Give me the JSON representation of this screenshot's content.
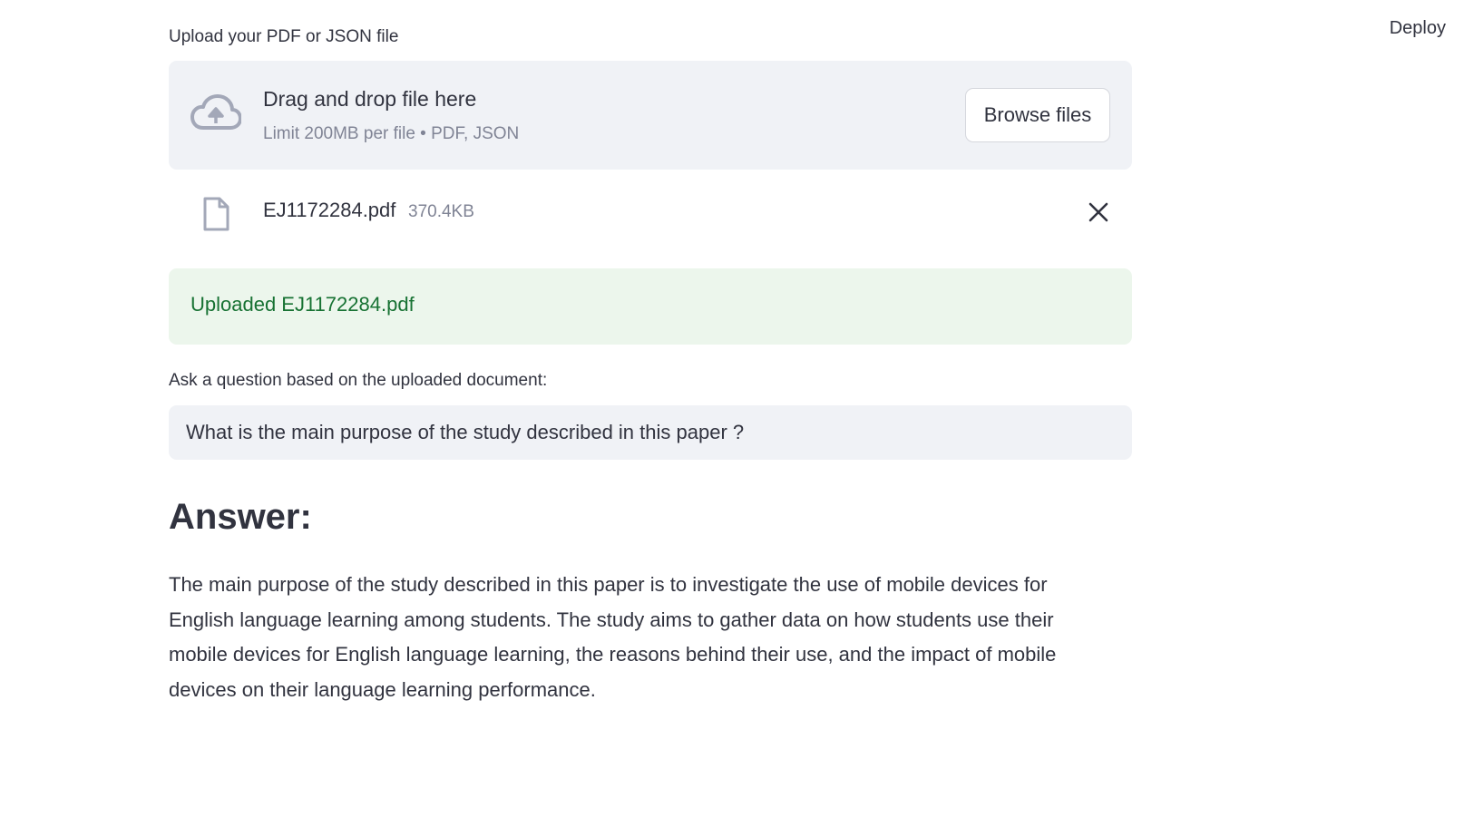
{
  "header": {
    "deploy_label": "Deploy"
  },
  "uploader": {
    "label": "Upload your PDF or JSON file",
    "dropzone_title": "Drag and drop file here",
    "dropzone_limits": "Limit 200MB per file • PDF, JSON",
    "browse_label": "Browse files",
    "file": {
      "name": "EJ1172284.pdf",
      "size": "370.4KB"
    }
  },
  "status": {
    "success_message": "Uploaded EJ1172284.pdf"
  },
  "question": {
    "label": "Ask a question based on the uploaded document:",
    "value": "What is the main purpose of the study described in this paper ?"
  },
  "answer": {
    "heading": "Answer:",
    "text": "The main purpose of the study described in this paper is to investigate the use of mobile devices for English language learning among students. The study aims to gather data on how students use their mobile devices for English language learning, the reasons behind their use, and the impact of mobile devices on their language learning performance."
  },
  "icons": {
    "upload": "cloud-upload-icon",
    "file": "file-icon",
    "remove": "close-icon"
  },
  "colors": {
    "accent_success_bg": "#ecf6ec",
    "accent_success_text": "#177233",
    "input_bg": "#f0f2f6",
    "text": "#31333f",
    "muted": "#808495",
    "icon": "#a3a8b8"
  }
}
